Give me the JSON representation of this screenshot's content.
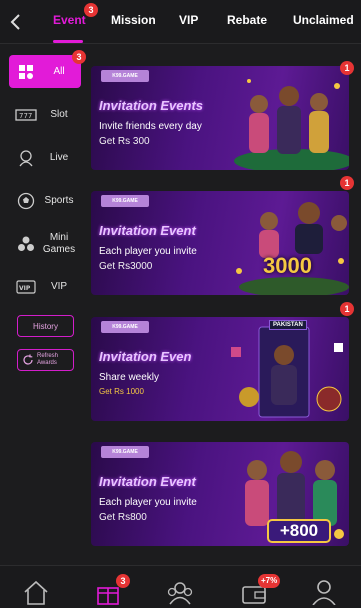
{
  "topbar": {
    "tabs": [
      {
        "label": "Event",
        "badge": "3",
        "active": true
      },
      {
        "label": "Mission"
      },
      {
        "label": "VIP"
      },
      {
        "label": "Rebate"
      },
      {
        "label": "Unclaimed"
      }
    ]
  },
  "sidebar": {
    "items": [
      {
        "label": "All",
        "icon": "grid-icon",
        "badge": "3",
        "active": true
      },
      {
        "label": "Slot",
        "icon": "slot-machine-icon"
      },
      {
        "label": "Live",
        "icon": "live-dealer-icon"
      },
      {
        "label": "Sports",
        "icon": "soccer-ball-icon"
      },
      {
        "label": "Mini Games",
        "icon": "cubes-icon"
      },
      {
        "label": "VIP",
        "icon": "vip-card-icon"
      }
    ],
    "history_label": "History",
    "refresh_label": "Refresh Awards"
  },
  "banners": [
    {
      "brand": "K99.GAME",
      "title": "Invitation Events",
      "line1": "Invite friends every day",
      "line2": "Get Rs 300",
      "badge": "1"
    },
    {
      "brand": "K99.GAME",
      "title": "Invitation Event",
      "line1": "Each player you invite",
      "line2": "Get Rs3000",
      "badge": "1",
      "amount": "3000"
    },
    {
      "brand": "K99.GAME",
      "title": "Invitation Even",
      "line1": "Share weekly",
      "line2": "Get Rs 1000",
      "badge": "1",
      "tag": "PAKISTAN"
    },
    {
      "brand": "K99.GAME",
      "title": "Invitation Event",
      "line1": "Each player you invite",
      "line2": "Get Rs800",
      "amount": "+800"
    }
  ],
  "bottomnav": {
    "items": [
      {
        "icon": "home-icon"
      },
      {
        "icon": "gift-icon",
        "badge": "3"
      },
      {
        "icon": "agents-icon"
      },
      {
        "icon": "wallet-icon",
        "badge": "+7%"
      },
      {
        "icon": "profile-icon"
      }
    ]
  },
  "colors": {
    "accent": "#e21bd8",
    "badge": "#e63434",
    "background": "#1c1c1e"
  }
}
